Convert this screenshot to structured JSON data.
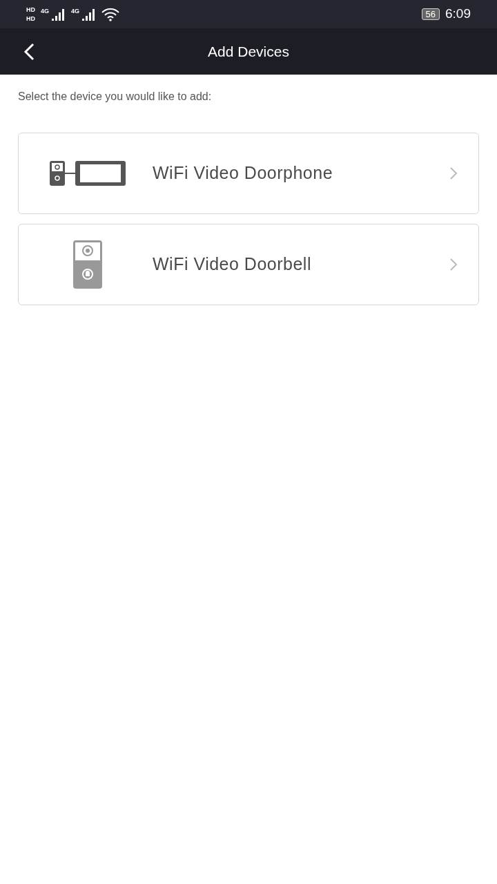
{
  "status_bar": {
    "sim_badges": [
      "HD",
      "HD"
    ],
    "networks": [
      "4G",
      "4G"
    ],
    "battery": "56",
    "time": "6:09"
  },
  "header": {
    "title": "Add Devices"
  },
  "prompt": "Select the device you would like to add:",
  "devices": [
    {
      "kind": "doorphone",
      "label": "WiFi Video Doorphone"
    },
    {
      "kind": "doorbell",
      "label": "WiFi Video Doorbell"
    }
  ]
}
